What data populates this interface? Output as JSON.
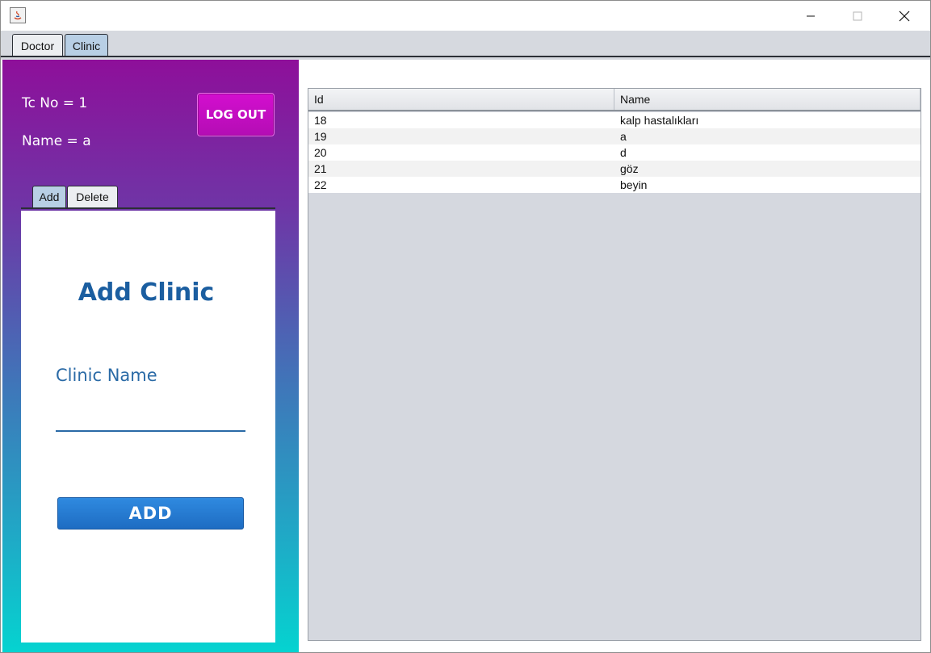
{
  "window": {
    "minimize_glyph": "—",
    "maximize_glyph": "☐",
    "close_glyph": "✕"
  },
  "main_tabs": [
    {
      "label": "Doctor"
    },
    {
      "label": "Clinic"
    }
  ],
  "user_info": {
    "tc_no": "Tc No = 1",
    "name": "Name = a"
  },
  "logout_label": "LOG OUT",
  "sub_tabs": [
    {
      "label": "Add"
    },
    {
      "label": "Delete"
    }
  ],
  "form": {
    "title": "Add Clinic",
    "field_label": "Clinic Name",
    "field_value": "",
    "add_label": "ADD"
  },
  "table": {
    "columns": [
      "Id",
      "Name"
    ],
    "rows": [
      {
        "id": "18",
        "name": "kalp hastalıkları"
      },
      {
        "id": "19",
        "name": "a"
      },
      {
        "id": "20",
        "name": "d"
      },
      {
        "id": "21",
        "name": "göz"
      },
      {
        "id": "22",
        "name": "beyin"
      }
    ]
  },
  "colors": {
    "gradient_top": "#8e0f9a",
    "gradient_bottom": "#05d3d0",
    "logout": "#c80fc6",
    "accent_blue": "#1b5ea0",
    "add_button": "#2579d1"
  }
}
